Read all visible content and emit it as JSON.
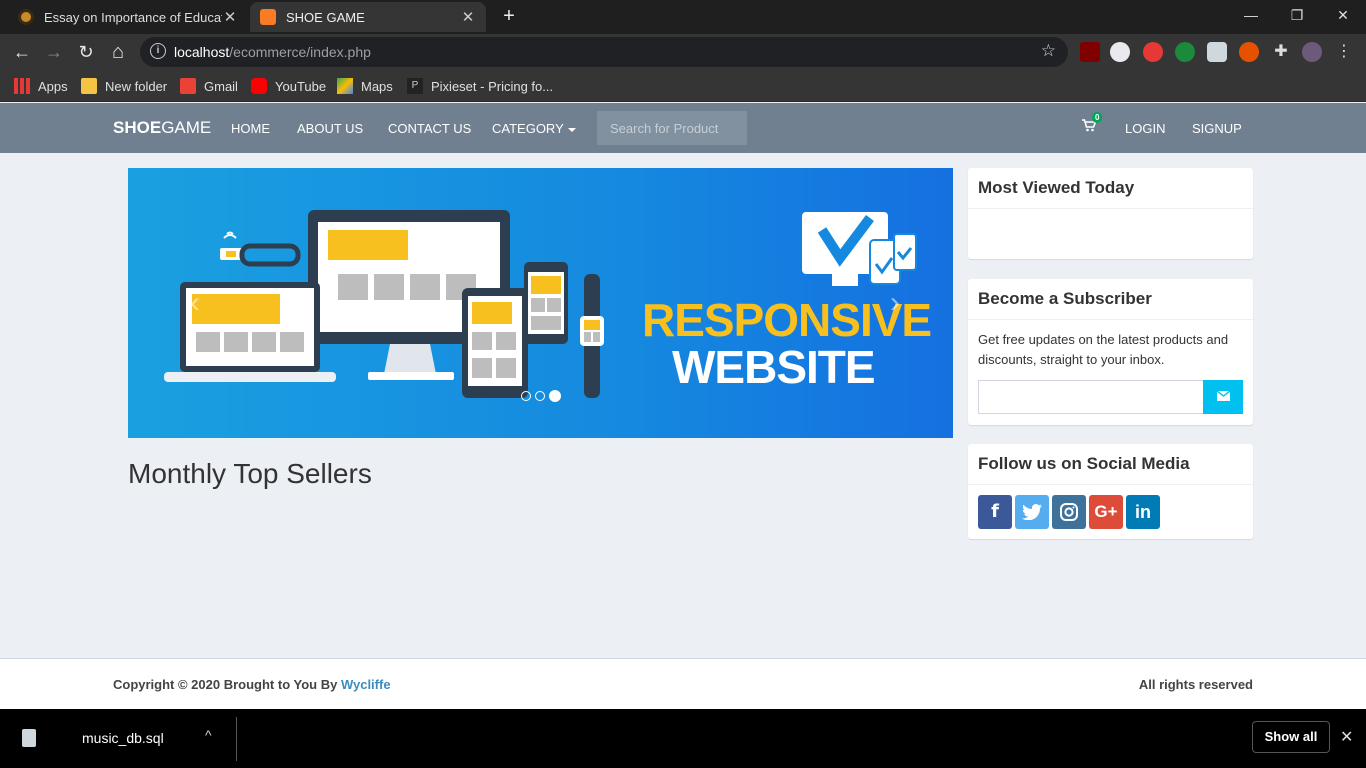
{
  "browser": {
    "tabs": [
      {
        "title": "Essay on Importance of Education",
        "close": "✕"
      },
      {
        "title": "SHOE GAME",
        "close": "✕"
      }
    ],
    "new_tab": "+",
    "window_controls": {
      "minimize": "—",
      "maximize": "❐",
      "close": "✕"
    },
    "nav": {
      "back": "←",
      "forward": "→",
      "reload": "↻",
      "home": "⌂"
    },
    "url_host": "localhost",
    "url_path": "/ecommerce/index.php",
    "bookmarks": [
      "Apps",
      "New folder",
      "Gmail",
      "YouTube",
      "Maps",
      "Pixieset - Pricing fo..."
    ],
    "colors": {
      "tabbar": "#1f1f1f",
      "toolbar": "#353535",
      "omnibox": "#202124"
    }
  },
  "site": {
    "brand_bold": "SHOE",
    "brand_rest": "GAME",
    "nav": {
      "home": "HOME",
      "about": "ABOUT US",
      "contact": "CONTACT US",
      "category": "CATEGORY"
    },
    "search_placeholder": "Search for Product",
    "cart_count": "0",
    "login": "LOGIN",
    "signup": "SIGNUP",
    "navbar_color": "#708090"
  },
  "carousel": {
    "headline_1": "RESPONSIVE",
    "headline_2": "WEBSITE",
    "prev": "‹",
    "next": "›",
    "slides": 3,
    "active_slide": 3
  },
  "main": {
    "section_title": "Monthly Top Sellers"
  },
  "sidebar": {
    "most_viewed_title": "Most Viewed Today",
    "subscriber_title": "Become a Subscriber",
    "subscriber_text": "Get free updates on the latest products and discounts, straight to your inbox.",
    "social_title": "Follow us on Social Media",
    "social": [
      {
        "name": "facebook",
        "glyph": "f",
        "color": "#3b5998"
      },
      {
        "name": "twitter",
        "glyph": "t",
        "color": "#55acee"
      },
      {
        "name": "instagram",
        "glyph": "◎",
        "color": "#3f729b"
      },
      {
        "name": "google-plus",
        "glyph": "G+",
        "color": "#dd4b39"
      },
      {
        "name": "linkedin",
        "glyph": "in",
        "color": "#007bb6"
      }
    ]
  },
  "footer": {
    "copyright_prefix": "Copyright © 2020 Brought to You By ",
    "author": "Wycliffe",
    "rights": "All rights reserved"
  },
  "downloads": {
    "file": "music_db.sql",
    "chevron": "^",
    "show_all": "Show all",
    "close": "✕"
  }
}
